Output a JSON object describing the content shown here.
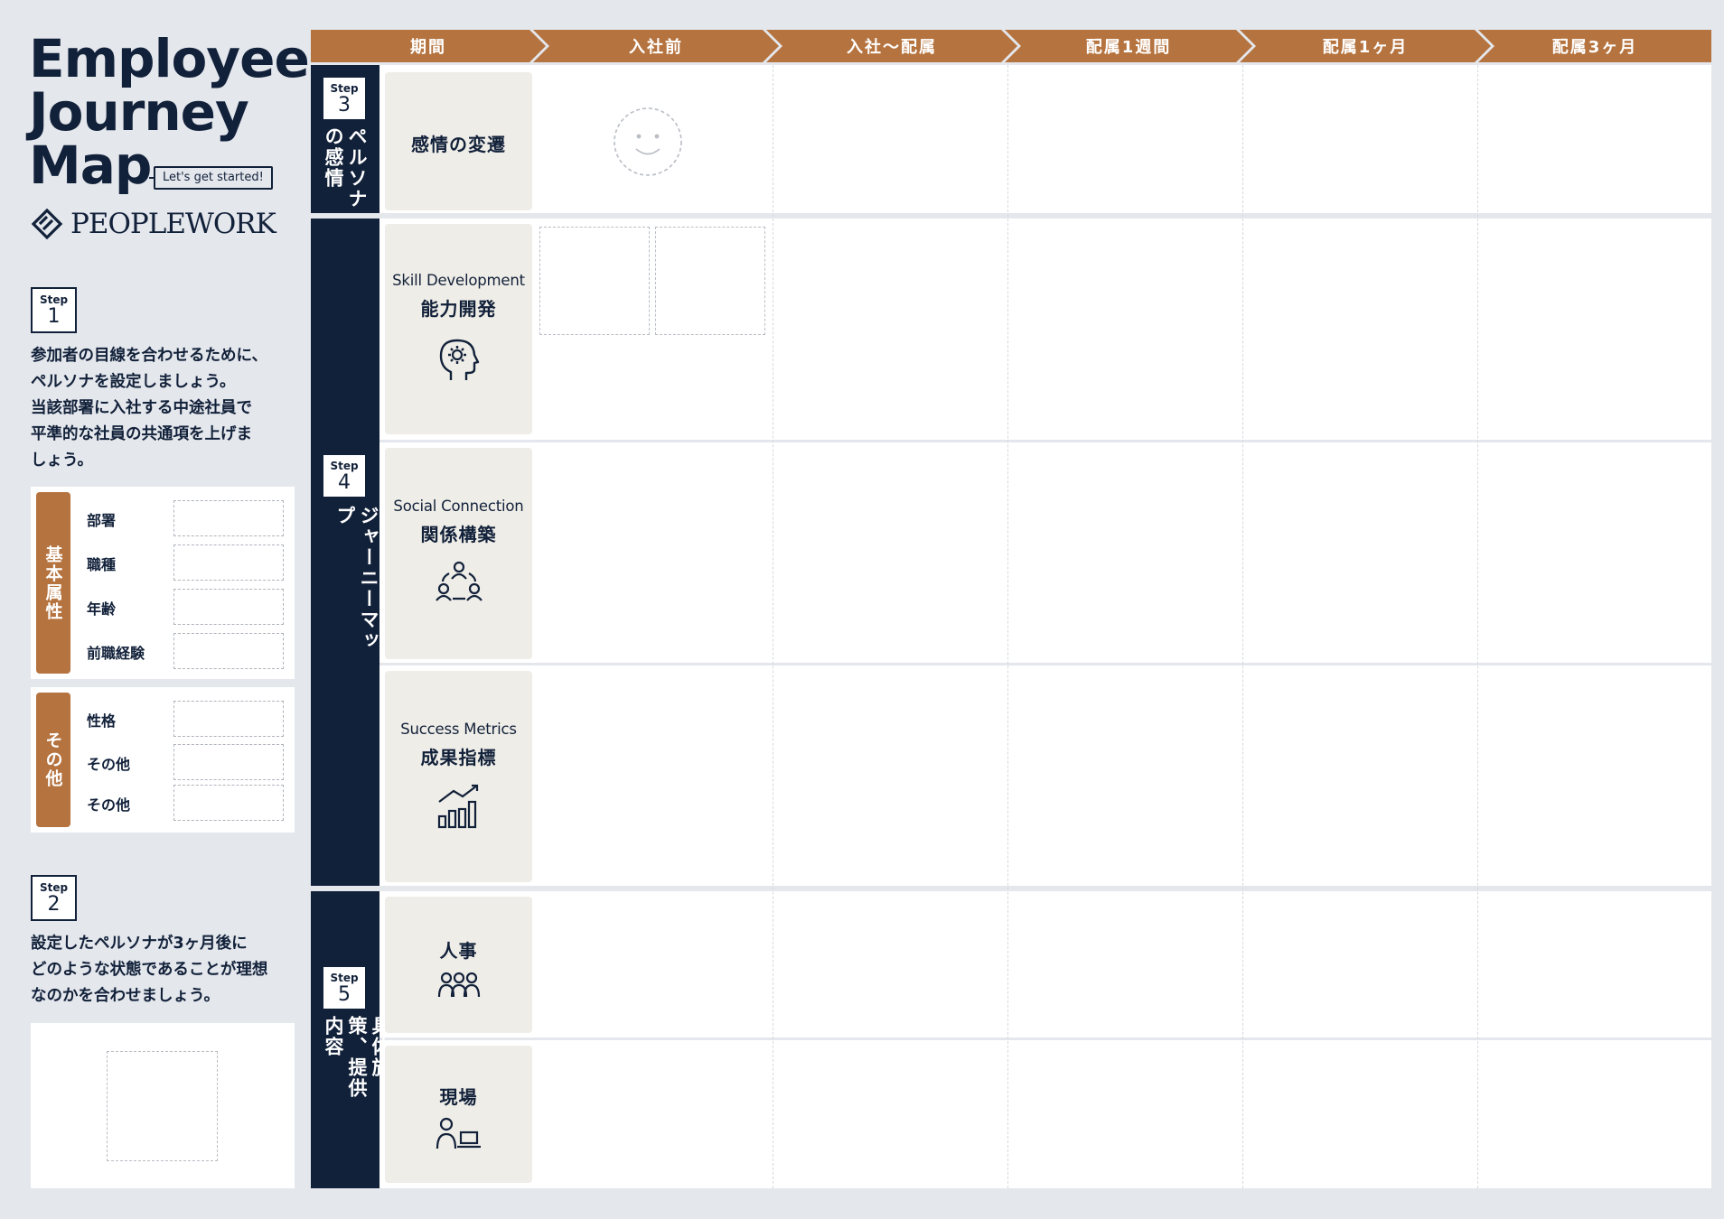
{
  "title": {
    "line1": "Employee",
    "line2": "Journey",
    "line3": "Map"
  },
  "tagline": "Let's get started!",
  "brand": "PEOPLEWORK",
  "step_word": "Step",
  "step1": {
    "num": "1",
    "lines": [
      "参加者の目線を合わせるために、",
      "ペルソナを設定しましょう。",
      "当該部署に入社する中途社員で",
      "平準的な社員の共通項を上げま",
      "しょう。"
    ],
    "basic_label": "基本属性",
    "basic_fields": [
      "部署",
      "職種",
      "年齢",
      "前職経験"
    ],
    "other_label": "その他",
    "other_fields": [
      "性格",
      "その他",
      "その他"
    ]
  },
  "step2": {
    "num": "2",
    "lines": [
      "設定したペルソナが3ヶ月後に",
      "どのような状態であることが理想",
      "なのかを合わせましょう。"
    ]
  },
  "columns": [
    "期間",
    "入社前",
    "入社〜配属",
    "配属1週間",
    "配属1ヶ月",
    "配属3ヶ月"
  ],
  "step3": {
    "num": "3",
    "label": "ペルソナの感情",
    "row": "感情の変遷"
  },
  "step4": {
    "num": "4",
    "label": "ジャーニーマップ",
    "rows": [
      {
        "en": "Skill Development",
        "jp": "能力開発",
        "icon": "head-gear-icon"
      },
      {
        "en": "Social Connection",
        "jp": "関係構築",
        "icon": "people-network-icon"
      },
      {
        "en": "Success Metrics",
        "jp": "成果指標",
        "icon": "bar-chart-icon"
      }
    ]
  },
  "step5": {
    "num": "5",
    "label": "具体施策、提供内容",
    "rows": [
      {
        "jp": "人事",
        "icon": "group-icon"
      },
      {
        "jp": "現場",
        "icon": "person-laptop-icon"
      }
    ]
  },
  "colors": {
    "navy": "#12213a",
    "accent": "#b5733f",
    "cell": "#efede7",
    "bg": "#e4e7ec"
  }
}
